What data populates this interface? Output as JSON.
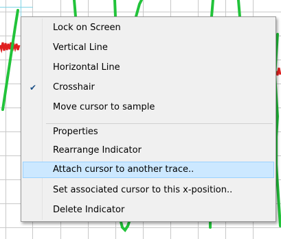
{
  "plot": {
    "trace_colors": {
      "primary": "#22c33a",
      "secondary": "#e02020",
      "cursor": "#7fd3e6",
      "grid": "#c8c8c8"
    }
  },
  "menu": {
    "items": [
      {
        "label": "Lock on Screen",
        "checked": false,
        "highlighted": false
      },
      {
        "label": "Vertical Line",
        "checked": false,
        "highlighted": false
      },
      {
        "label": "Horizontal Line",
        "checked": false,
        "highlighted": false
      },
      {
        "label": "Crosshair",
        "checked": true,
        "highlighted": false
      },
      {
        "label": "Move cursor to sample",
        "checked": false,
        "highlighted": false
      },
      {
        "label": "Properties",
        "checked": false,
        "highlighted": false
      },
      {
        "label": "Rearrange Indicator",
        "checked": false,
        "highlighted": false
      },
      {
        "label": "Attach cursor to another trace..",
        "checked": false,
        "highlighted": true
      },
      {
        "label": "Set associated cursor to this x-position..",
        "checked": false,
        "highlighted": false
      },
      {
        "label": "Delete Indicator",
        "checked": false,
        "highlighted": false
      }
    ],
    "check_glyph": "✔",
    "check_icon": "checkmark-icon"
  }
}
